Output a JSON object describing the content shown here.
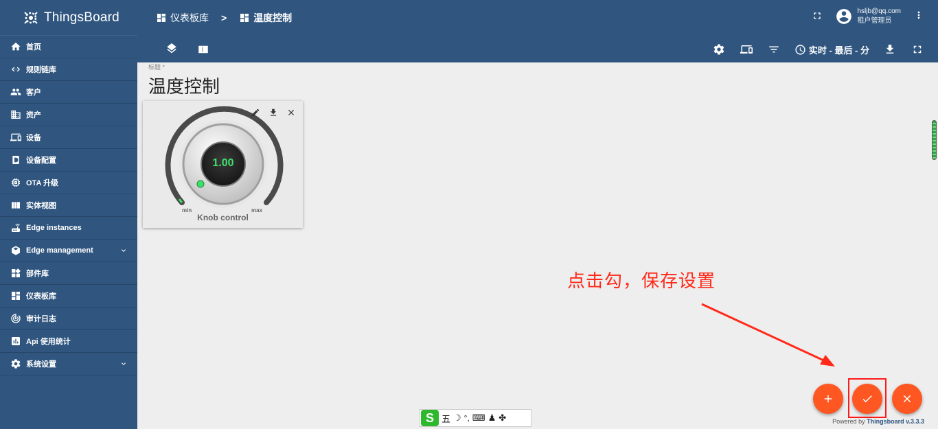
{
  "app": {
    "name": "ThingsBoard"
  },
  "sidebar": {
    "items": [
      {
        "label": "首页",
        "icon": "home-icon"
      },
      {
        "label": "规则链库",
        "icon": "code-arrows-icon"
      },
      {
        "label": "客户",
        "icon": "people-icon"
      },
      {
        "label": "资产",
        "icon": "domain-icon"
      },
      {
        "label": "设备",
        "icon": "devices-icon"
      },
      {
        "label": "设备配置",
        "icon": "device-profile-icon"
      },
      {
        "label": "OTA 升级",
        "icon": "memory-chip-icon"
      },
      {
        "label": "实体视图",
        "icon": "view-quilt-icon"
      },
      {
        "label": "Edge instances",
        "icon": "router-icon"
      },
      {
        "label": "Edge management",
        "icon": "settings-input-icon",
        "expandable": true
      },
      {
        "label": "部件库",
        "icon": "widgets-icon"
      },
      {
        "label": "仪表板库",
        "icon": "dashboard-icon"
      },
      {
        "label": "审计日志",
        "icon": "track-changes-icon"
      },
      {
        "label": "Api 使用统计",
        "icon": "insert-chart-icon"
      },
      {
        "label": "系统设置",
        "icon": "gear-icon",
        "expandable": true
      }
    ]
  },
  "header": {
    "breadcrumb": {
      "parent": "仪表板库",
      "separator": ">",
      "current": "温度控制"
    },
    "user": {
      "email": "hsljb@qq.com",
      "role": "租户管理员"
    },
    "timewindow": "实时 - 最后 - 分"
  },
  "dashboard": {
    "title_label": "标题 *",
    "title": "温度控制",
    "widget": {
      "value": "1.00",
      "min_label": "min",
      "max_label": "max",
      "name": "Knob control"
    }
  },
  "annotation": {
    "text": "点击勾，保存设置"
  },
  "ime": {
    "logo": "S",
    "mode": "五",
    "punct": "°,"
  },
  "footer": {
    "powered_prefix": "Powered by",
    "brand": "Thingsboard",
    "version": "v.3.3.3"
  },
  "colors": {
    "primary": "#305680",
    "accent": "#ff5722",
    "annotation": "#ff2a1a",
    "knob_value": "#3fe06a"
  }
}
